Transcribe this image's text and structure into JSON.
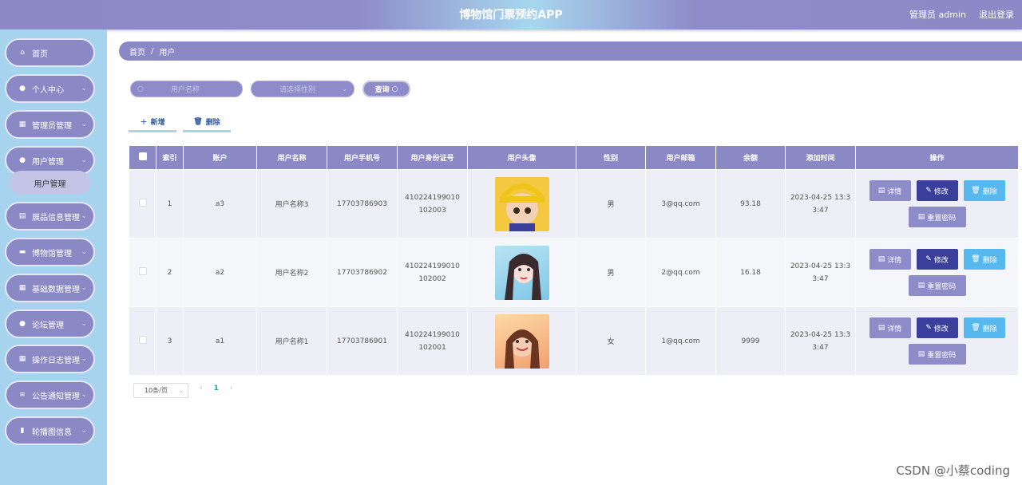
{
  "header": {
    "title": "博物馆门票预约APP",
    "user": "管理员 admin",
    "logout": "退出登录"
  },
  "sidebar": {
    "items": [
      {
        "label": "首页",
        "icon": "⌂",
        "arrow": false
      },
      {
        "label": "个人中心",
        "icon": "●",
        "arrow": true
      },
      {
        "label": "管理员管理",
        "icon": "▦",
        "arrow": true
      },
      {
        "label": "用户管理",
        "icon": "●",
        "arrow": true
      },
      {
        "label": "展品信息管理",
        "icon": "▤",
        "arrow": true
      },
      {
        "label": "博物馆管理",
        "icon": "▬",
        "arrow": true
      },
      {
        "label": "基础数据管理",
        "icon": "▦",
        "arrow": true
      },
      {
        "label": "论坛管理",
        "icon": "●",
        "arrow": true
      },
      {
        "label": "操作日志管理",
        "icon": "▦",
        "arrow": true
      },
      {
        "label": "公告通知管理",
        "icon": "≡",
        "arrow": true
      },
      {
        "label": "轮播图信息",
        "icon": "▮",
        "arrow": true
      }
    ],
    "submenu_label": "用户管理"
  },
  "breadcrumb": {
    "home": "首页",
    "sep": "/",
    "current": "用户"
  },
  "search": {
    "name_placeholder": "用户名称",
    "gender_placeholder": "请选择性别",
    "query_label": "查询"
  },
  "actions": {
    "add_label": "新增",
    "delete_label": "删除"
  },
  "table": {
    "headers": [
      "索引",
      "账户",
      "用户名称",
      "用户手机号",
      "用户身份证号",
      "用户头像",
      "性别",
      "用户邮箱",
      "余额",
      "添加时间",
      "操作"
    ],
    "rows": [
      {
        "index": "1",
        "account": "a3",
        "name": "用户名称3",
        "phone": "17703786903",
        "idcard": "410224199010102003",
        "gender": "男",
        "email": "3@qq.com",
        "balance": "93.18",
        "time": "2023-04-25 13:33:47"
      },
      {
        "index": "2",
        "account": "a2",
        "name": "用户名称2",
        "phone": "17703786902",
        "idcard": "410224199010102002",
        "gender": "男",
        "email": "2@qq.com",
        "balance": "16.18",
        "time": "2023-04-25 13:33:47"
      },
      {
        "index": "3",
        "account": "a1",
        "name": "用户名称1",
        "phone": "17703786901",
        "idcard": "410224199010102001",
        "gender": "女",
        "email": "1@qq.com",
        "balance": "9999",
        "time": "2023-04-25 13:33:47"
      }
    ],
    "op_labels": {
      "detail": "详情",
      "edit": "修改",
      "delete": "删除",
      "reset": "重置密码"
    }
  },
  "pagination": {
    "page_size": "10条/页",
    "prev": "‹",
    "current_page": "1",
    "next": "›"
  },
  "watermark": "CSDN @小蔡coding",
  "colors": {
    "primary": "#8b88c6",
    "sidebar_bg": "#a6d4ee",
    "edit": "#3b3f9c",
    "delete": "#57b8ef"
  }
}
